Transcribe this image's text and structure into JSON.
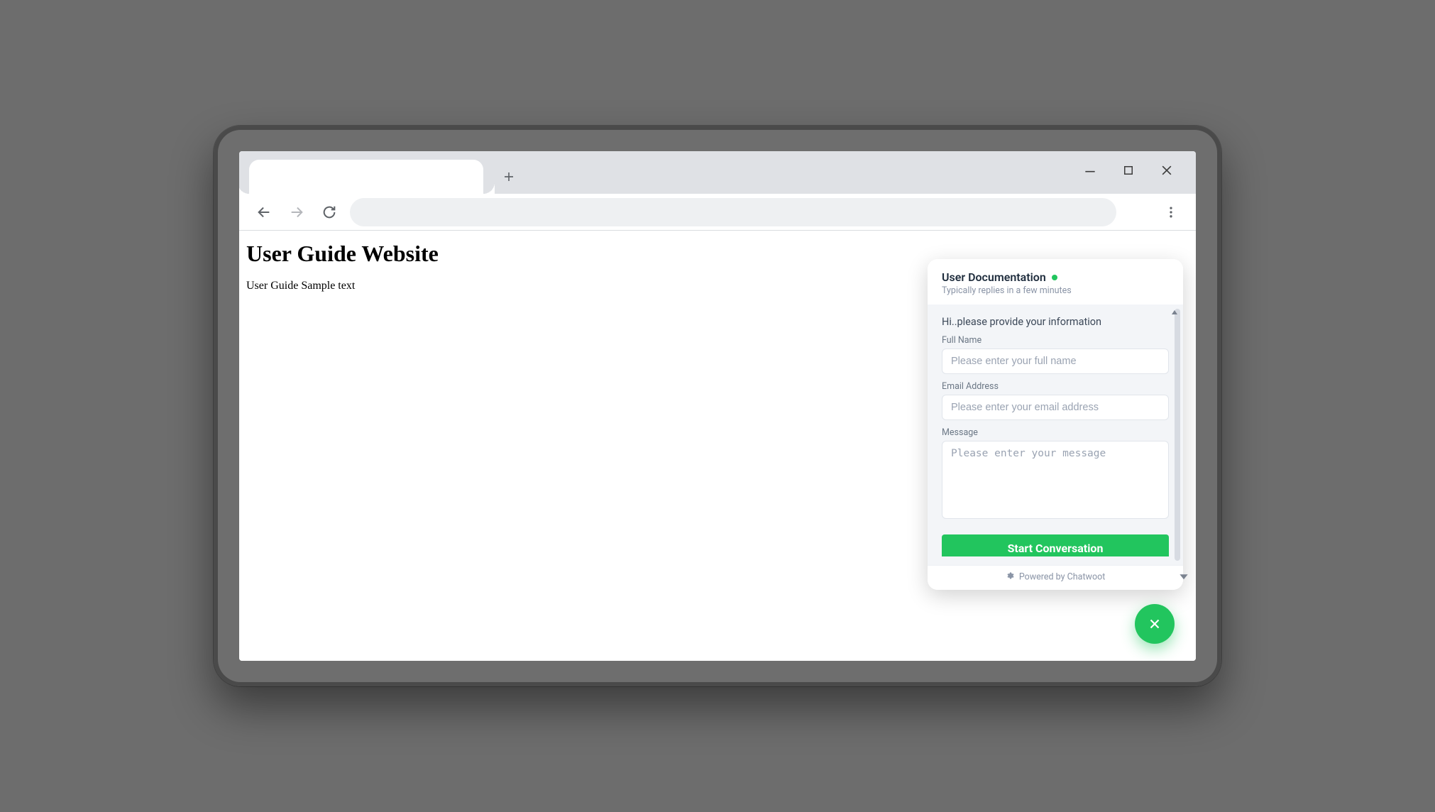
{
  "page": {
    "heading": "User Guide Website",
    "body": "User Guide Sample text"
  },
  "chat": {
    "title": "User Documentation",
    "subtitle": "Typically replies in a few minutes",
    "prompt": "Hi..please provide your information",
    "fields": {
      "full_name": {
        "label": "Full Name",
        "placeholder": "Please enter your full name"
      },
      "email": {
        "label": "Email Address",
        "placeholder": "Please enter your email address"
      },
      "message": {
        "label": "Message",
        "placeholder": "Please enter your message"
      }
    },
    "cta": "Start Conversation",
    "footer": "Powered by Chatwoot"
  },
  "colors": {
    "accent": "#22c55e"
  }
}
